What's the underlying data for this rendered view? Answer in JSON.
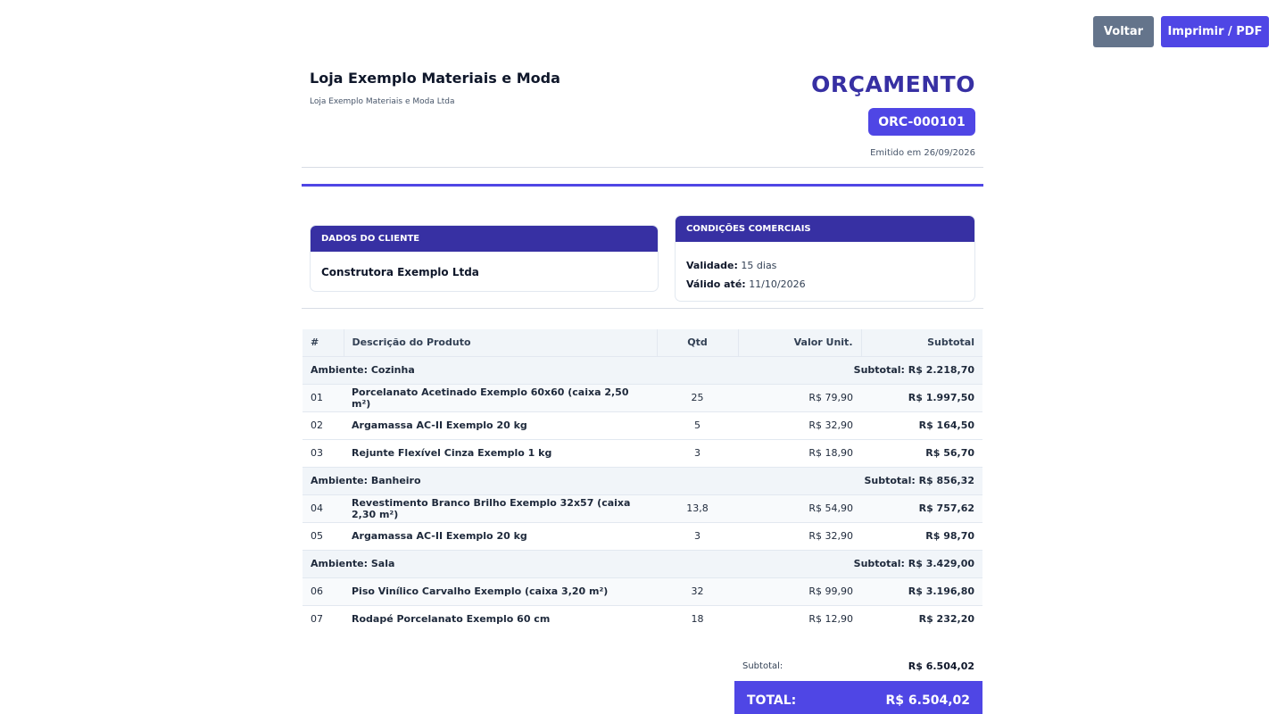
{
  "actions": {
    "back_label": "Voltar",
    "print_label": "Imprimir / PDF"
  },
  "company": {
    "name": "Loja Exemplo Materiais e Moda",
    "legal_name": "Loja Exemplo Materiais e Moda Ltda"
  },
  "document": {
    "title": "ORÇAMENTO",
    "number": "ORC-000101",
    "issued": "Emitido em 26/09/2026"
  },
  "client": {
    "heading": "DADOS DO CLIENTE",
    "name": "Construtora Exemplo Ltda"
  },
  "conditions": {
    "heading": "CONDIÇÕES COMERCIAIS",
    "validity_label": "Validade:",
    "validity_value": "15 dias",
    "valid_until_label": "Válido até:",
    "valid_until_value": "11/10/2026"
  },
  "table": {
    "headers": [
      "#",
      "Descrição do Produto",
      "Qtd",
      "Valor Unit.",
      "Subtotal"
    ],
    "sections": [
      {
        "name": "Ambiente: Cozinha",
        "subtotal": "Subtotal: R$ 2.218,70",
        "items": [
          {
            "num": "01",
            "desc": "Porcelanato Acetinado Exemplo 60x60 (caixa 2,50 m²)",
            "qty": "25",
            "unit": "R$ 79,90",
            "sub": "R$ 1.997,50"
          },
          {
            "num": "02",
            "desc": "Argamassa AC-II Exemplo 20 kg",
            "qty": "5",
            "unit": "R$ 32,90",
            "sub": "R$ 164,50"
          },
          {
            "num": "03",
            "desc": "Rejunte Flexível Cinza Exemplo 1 kg",
            "qty": "3",
            "unit": "R$ 18,90",
            "sub": "R$ 56,70"
          }
        ]
      },
      {
        "name": "Ambiente: Banheiro",
        "subtotal": "Subtotal: R$ 856,32",
        "items": [
          {
            "num": "04",
            "desc": "Revestimento Branco Brilho Exemplo 32x57 (caixa 2,30 m²)",
            "qty": "13,8",
            "unit": "R$ 54,90",
            "sub": "R$ 757,62"
          },
          {
            "num": "05",
            "desc": "Argamassa AC-II Exemplo 20 kg",
            "qty": "3",
            "unit": "R$ 32,90",
            "sub": "R$ 98,70"
          }
        ]
      },
      {
        "name": "Ambiente: Sala",
        "subtotal": "Subtotal: R$ 3.429,00",
        "items": [
          {
            "num": "06",
            "desc": "Piso Vinílico Carvalho Exemplo (caixa 3,20 m²)",
            "qty": "32",
            "unit": "R$ 99,90",
            "sub": "R$ 3.196,80"
          },
          {
            "num": "07",
            "desc": "Rodapé Porcelanato Exemplo 60 cm",
            "qty": "18",
            "unit": "R$ 12,90",
            "sub": "R$ 232,20"
          }
        ]
      }
    ]
  },
  "totals": {
    "subtotal_label": "Subtotal:",
    "subtotal_value": "R$ 6.504,02",
    "total_label": "TOTAL:",
    "total_value": "R$ 6.504,02"
  },
  "colors": {
    "accent": "#4f46e5",
    "accent_dark": "#3730a3",
    "back_button": "#64748b"
  }
}
